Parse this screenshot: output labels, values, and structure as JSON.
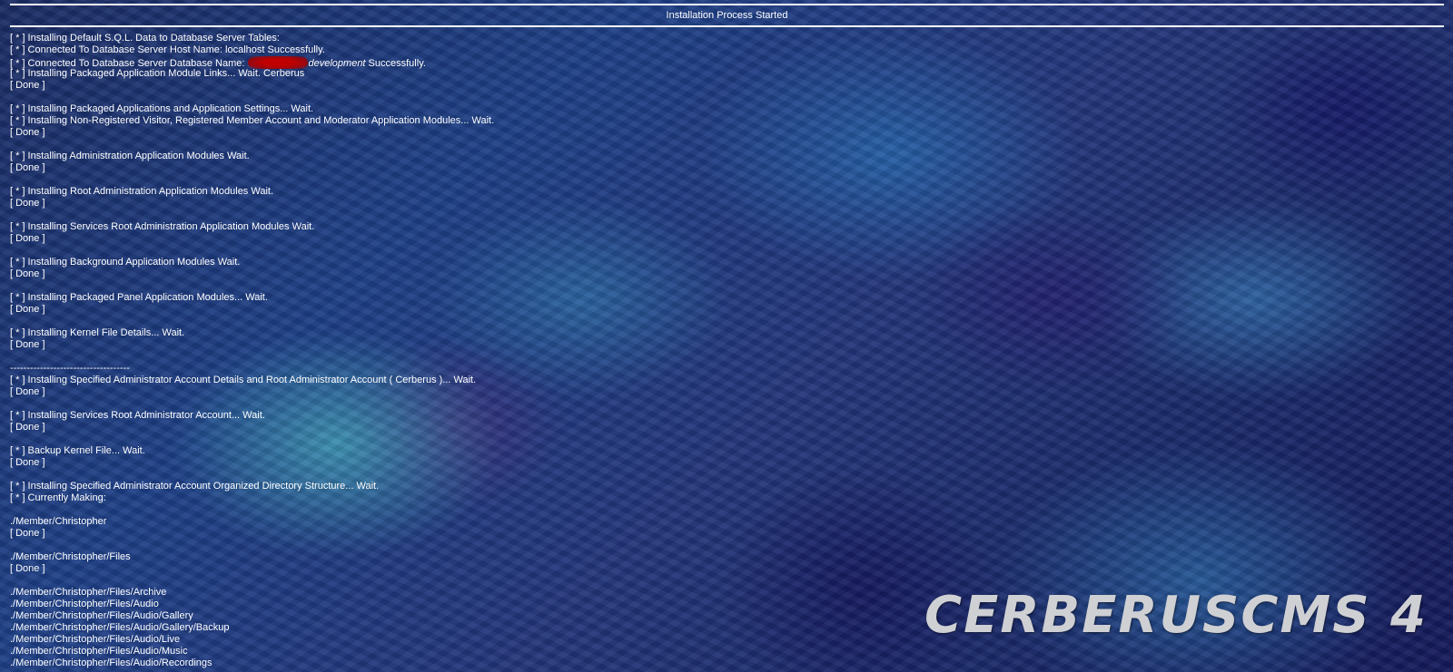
{
  "header": {
    "title": "Installation Process Started"
  },
  "log": {
    "lines": [
      "[ * ] Installing Default S.Q.L. Data to Database Server Tables:",
      "[ * ] Connected To Database Server Host Name: localhost Successfully.",
      null,
      "[ * ] Installing Packaged Application Module Links... Wait. Cerberus",
      "[ Done ]",
      "",
      "[ * ] Installing Packaged Applications and Application Settings... Wait.",
      "[ * ] Installing Non-Registered Visitor, Registered Member Account and Moderator Application Modules... Wait.",
      "[ Done ]",
      "",
      "[ * ] Installing Administration Application Modules Wait.",
      "[ Done ]",
      "",
      "[ * ] Installing Root Administration Application Modules Wait.",
      "[ Done ]",
      "",
      "[ * ] Installing Services Root Administration Application Modules Wait.",
      "[ Done ]",
      "",
      "[ * ] Installing Background Application Modules Wait.",
      "[ Done ]",
      "",
      "[ * ] Installing Packaged Panel Application Modules... Wait.",
      "[ Done ]",
      "",
      "[ * ] Installing Kernel File Details... Wait.",
      "[ Done ]",
      "",
      "------------------------------------",
      "[ * ] Installing Specified Administrator Account Details and Root Administrator Account ( Cerberus )... Wait.",
      "[ Done ]",
      "",
      "[ * ] Installing Services Root Administrator Account... Wait.",
      "[ Done ]",
      "",
      "[ * ] Backup Kernel File... Wait.",
      "[ Done ]",
      "",
      "[ * ] Installing Specified Administrator Account Organized Directory Structure... Wait.",
      "[ * ] Currently Making:",
      "",
      "./Member/Christopher",
      "[ Done ]",
      "",
      "./Member/Christopher/Files",
      "[ Done ]",
      "",
      "./Member/Christopher/Files/Archive",
      "./Member/Christopher/Files/Audio",
      "./Member/Christopher/Files/Audio/Gallery",
      "./Member/Christopher/Files/Audio/Gallery/Backup",
      "./Member/Christopher/Files/Audio/Live",
      "./Member/Christopher/Files/Audio/Music",
      "./Member/Christopher/Files/Audio/Recordings"
    ],
    "db_line": {
      "prefix": "[ * ] Connected To Database Server Database Name: ",
      "db_name": "development",
      "suffix": " Successfully."
    }
  },
  "logo": {
    "text": "CERBERUSCMS 4"
  },
  "colors": {
    "text": "#ffffff",
    "logo": "#cfd0d4",
    "redaction": "#c00000",
    "background": "#1d3f86"
  }
}
